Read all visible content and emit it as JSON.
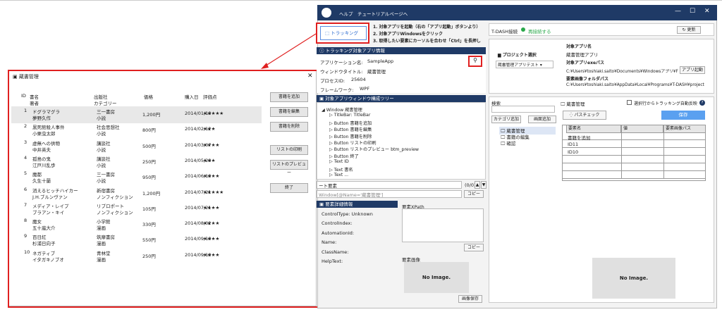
{
  "books_window": {
    "title": "蔵書管理",
    "columns": {
      "id": "ID",
      "title": "書名",
      "author": "著者",
      "publisher": "出版社",
      "category": "カテゴリー",
      "price": "価格",
      "date": "購入日",
      "rating": "評価点"
    },
    "rows": [
      {
        "id": "1",
        "title": "ドグラマグラ",
        "author": "夢野久作",
        "publisher": "三一書房",
        "category": "小説",
        "price": "1,200円",
        "date": "2014/01/10",
        "rating": "★★★★★"
      },
      {
        "id": "2",
        "title": "黒死館殺人事件",
        "author": "小栗虫太郎",
        "publisher": "社会思想社",
        "category": "小説",
        "price": "800円",
        "date": "2014/02/12",
        "rating": "★★★"
      },
      {
        "id": "3",
        "title": "虚無への供物",
        "author": "中井英夫",
        "publisher": "講談社",
        "category": "小説",
        "price": "500円",
        "date": "2014/03/07",
        "rating": "★★★★"
      },
      {
        "id": "4",
        "title": "孤島の鬼",
        "author": "江戸川乱歩",
        "publisher": "講談社",
        "category": "小説",
        "price": "250円",
        "date": "2014/05/20",
        "rating": "★★★"
      },
      {
        "id": "5",
        "title": "魔都",
        "author": "久生十蘭",
        "publisher": "三一書房",
        "category": "小説",
        "price": "950円",
        "date": "2014/06/10",
        "rating": "★★★★"
      },
      {
        "id": "6",
        "title": "消えるヒッチハイカー",
        "author": "J.H.ブルンヴァン",
        "publisher": "新宿書房",
        "category": "ノンフィクション",
        "price": "1,200円",
        "date": "2014/07/21",
        "rating": "★★★★★"
      },
      {
        "id": "7",
        "title": "メディア・レイプ",
        "author": "ブラアン・キイ",
        "publisher": "リブロポート",
        "category": "ノンフィクション",
        "price": "105円",
        "date": "2014/07/21",
        "rating": "★★★★"
      },
      {
        "id": "8",
        "title": "魔女",
        "author": "五十嵐大介",
        "publisher": "小学館",
        "category": "漫画",
        "price": "330円",
        "date": "2014/08/02",
        "rating": "★★★★"
      },
      {
        "id": "9",
        "title": "百日紅",
        "author": "杉浦日向子",
        "publisher": "筑摩書房",
        "category": "漫画",
        "price": "550円",
        "date": "2014/09/10",
        "rating": "★★★★"
      },
      {
        "id": "10",
        "title": "ネガティブ",
        "author": "イタガキノブオ",
        "publisher": "青林堂",
        "category": "漫画",
        "price": "250円",
        "date": "2014/09/10",
        "rating": "★★★★"
      }
    ],
    "buttons": {
      "add": "書籍を追加",
      "edit": "書籍を編集",
      "delete": "書籍を削除",
      "print": "リストの印刷",
      "preview": "リストのプレビュー",
      "exit": "終了"
    }
  },
  "app": {
    "menu_help": "ヘルプ",
    "menu_tutorial": "チュートリアルページへ",
    "tracking_btn": "トラッキング",
    "steps": [
      "1. 対象アプリを起動（右の「アプリ起動」ボタンより）",
      "2. 対象アプリWindowsをクリック",
      "3. 取得したい要素にカーソルを合わせ「Ctrl」を長押し"
    ],
    "target_info_title": "トラッキング対象アプリ情報",
    "app_name_label": "アプリケーション名:",
    "app_name": "SampleApp",
    "window_title_label": "ウィンドウタイトル:",
    "window_title": "蔵書管理",
    "process_label": "プロセスID:",
    "process_id": "25604",
    "framework_label": "フレームワーク:",
    "framework": "WPF",
    "tree_title": "対象アプリウィンドウ構成ツリー",
    "tree": [
      "Window 蔵書管理",
      "TitleBar: TitleBar",
      "Button 書籍を追加",
      "Button 書籍を編集",
      "Button 書籍を削除",
      "Button リストの印刷",
      "Button リストのプレビュー btm_preview",
      "Button 終了",
      "Text ID",
      "Text 書名",
      "Text ..."
    ],
    "search_el_placeholder": "ート要素",
    "search_count": "(0/0)",
    "xpath_value": "Window[@Name='蔵書管理']",
    "copy": "コピー",
    "detail_title": "要素詳細情報",
    "details": [
      "ControlType:  Unknown",
      "ControlIndex:",
      "AutomationId:",
      "Name:",
      "ClassName:",
      "HelpText:"
    ],
    "xpath_label": "要素XPath",
    "image_label": "要素画像",
    "no_image": "No Image.",
    "save_image": "画像保存",
    "tdash_label": "T-DASH接続",
    "tdash_status": "再接続する",
    "refresh": "更新",
    "project_select_label": "プロジェクト選択",
    "project_value": "蔵書管理アプリテスト",
    "target_app_name_label": "対象アプリ名",
    "target_app_name": "蔵書管理アプリ",
    "exe_path_label": "対象アプリexeパス",
    "exe_path": "C:¥Users¥toshiaki.saito¥Documents¥Windowsアプリ¥F",
    "launch": "アプリ起動",
    "img_folder_label": "要素画像フォルダパス",
    "img_folder": "C:¥Users¥toshiaki.saito¥AppData¥Local¥Programs¥T-DASH¥project",
    "search_label": "検索",
    "add_category": "カテゴリ追加",
    "add_screen": "画面追加",
    "screens": [
      "蔵書管理",
      "書籍の編集",
      "確認"
    ],
    "screen_header": "蔵書管理",
    "auto_reflect": "選択行からトラッキング自動反映",
    "pass_check": "パスチェック",
    "save": "保存",
    "grid_headers": [
      "要素名",
      "値",
      "要素画像パス"
    ],
    "grid_rows": [
      "書籍を追加",
      "ID11",
      "ID10"
    ]
  }
}
